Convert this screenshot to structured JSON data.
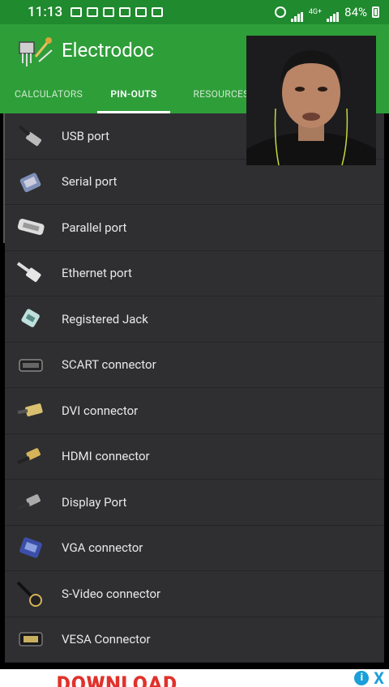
{
  "status": {
    "time": "11:13",
    "battery": "84%",
    "network": "4G+"
  },
  "app": {
    "title": "Electrodoc",
    "tabs": [
      {
        "label": "CALCULATORS",
        "selected": false
      },
      {
        "label": "PIN-OUTS",
        "selected": true
      },
      {
        "label": "RESOURCES",
        "selected": false
      }
    ]
  },
  "items": [
    {
      "label": "USB port",
      "icon": "usb-plug-icon"
    },
    {
      "label": "Serial port",
      "icon": "serial-connector-icon"
    },
    {
      "label": "Parallel port",
      "icon": "parallel-connector-icon"
    },
    {
      "label": "Ethernet port",
      "icon": "ethernet-plug-icon"
    },
    {
      "label": "Registered Jack",
      "icon": "rj-plug-icon"
    },
    {
      "label": "SCART connector",
      "icon": "scart-plug-icon"
    },
    {
      "label": "DVI connector",
      "icon": "dvi-plug-icon"
    },
    {
      "label": "HDMI connector",
      "icon": "hdmi-plug-icon"
    },
    {
      "label": "Display Port",
      "icon": "displayport-plug-icon"
    },
    {
      "label": "VGA connector",
      "icon": "vga-plug-icon"
    },
    {
      "label": "S-Video connector",
      "icon": "svideo-plug-icon"
    },
    {
      "label": "VESA Connector",
      "icon": "vesa-plug-icon"
    }
  ],
  "ad": {
    "text": "DOWNLOAD",
    "info_icon": "i",
    "close_icon": "X"
  },
  "colors": {
    "statusbar": "#1f8a2e",
    "appbar": "#2e9e39",
    "list_bg": "#2f2f31",
    "ad_red": "#e0322c",
    "ad_blue": "#1a9fd8"
  }
}
